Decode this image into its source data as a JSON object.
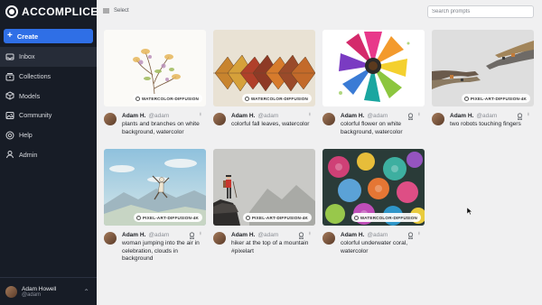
{
  "app": {
    "name": "ACCOMPLICE"
  },
  "sidebar": {
    "create_label": "Create",
    "items": [
      {
        "label": "Inbox",
        "icon": "inbox-icon",
        "active": true
      },
      {
        "label": "Collections",
        "icon": "collections-icon",
        "active": false
      },
      {
        "label": "Models",
        "icon": "models-icon",
        "active": false
      },
      {
        "label": "Community",
        "icon": "community-icon",
        "active": false
      },
      {
        "label": "Help",
        "icon": "help-icon",
        "active": false
      },
      {
        "label": "Admin",
        "icon": "admin-icon",
        "active": false
      }
    ],
    "user": {
      "name": "Adam Howell",
      "handle": "@adam"
    }
  },
  "toolbar": {
    "select_label": "Select",
    "search_placeholder": "Search prompts"
  },
  "cards": [
    {
      "author": "Adam H.",
      "handle": "@adam",
      "model": "WATERCOLOR-DIFFUSION",
      "prompt": "plants and branches on white background, watercolor",
      "image": "watercolor-plants"
    },
    {
      "author": "Adam H.",
      "handle": "@adam",
      "model": "WATERCOLOR-DIFFUSION",
      "prompt": "colorful fall leaves, watercolor",
      "image": "fall-leaves"
    },
    {
      "author": "Adam H.",
      "handle": "@adam",
      "model": "",
      "prompt": "colorful flower on white background, watercolor",
      "image": "colorful-flower"
    },
    {
      "author": "Adam H.",
      "handle": "@adam",
      "model": "PIXEL-ART-DIFFUSION-4K",
      "prompt": "two robots touching fingers",
      "image": "robot-hands"
    },
    {
      "author": "Adam H.",
      "handle": "@adam",
      "model": "PIXEL-ART-DIFFUSION-4K",
      "prompt": "woman jumping into the air in celebration, clouds in background",
      "image": "jumping-woman"
    },
    {
      "author": "Adam H.",
      "handle": "@adam",
      "model": "PIXEL-ART-DIFFUSION-4K",
      "prompt": "hiker at the top of a mountain #pixelart",
      "image": "hiker"
    },
    {
      "author": "Adam H.",
      "handle": "@adam",
      "model": "WATERCOLOR-DIFFUSION",
      "prompt": "colorful underwater coral, watercolor",
      "image": "coral"
    }
  ],
  "colors": {
    "sidebar_bg": "#171c26",
    "accent": "#2f6fe6",
    "page_bg": "#f0f0f1"
  }
}
